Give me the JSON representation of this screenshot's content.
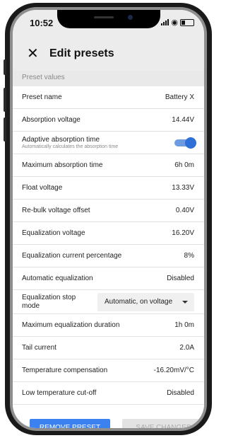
{
  "status_bar": {
    "time": "10:52",
    "wifi_glyph": "◉"
  },
  "appbar": {
    "close_glyph": "✕",
    "title": "Edit presets"
  },
  "section": {
    "header": "Preset values"
  },
  "rows": [
    {
      "label": "Preset name",
      "value": "Battery X"
    },
    {
      "label": "Absorption voltage",
      "value": "14.44V"
    },
    {
      "label": "Adaptive absorption time",
      "sublabel": "Automatically calculates the absorption time",
      "toggle_on": true
    },
    {
      "label": "Maximum absorption time",
      "value": "6h 0m"
    },
    {
      "label": "Float voltage",
      "value": "13.33V"
    },
    {
      "label": "Re-bulk voltage offset",
      "value": "0.40V"
    },
    {
      "label": "Equalization voltage",
      "value": "16.20V"
    },
    {
      "label": "Equalization current percentage",
      "value": "8%"
    },
    {
      "label": "Automatic equalization",
      "value": "Disabled"
    },
    {
      "label": "Equalization stop mode",
      "select_value": "Automatic, on voltage"
    },
    {
      "label": "Maximum equalization duration",
      "value": "1h 0m"
    },
    {
      "label": "Tail current",
      "value": "2.0A"
    },
    {
      "label": "Temperature compensation",
      "value": "-16.20mV/°C"
    },
    {
      "label": "Low temperature cut-off",
      "value": "Disabled"
    }
  ],
  "actions": {
    "remove": "REMOVE PRESET",
    "save": "SAVE CHANGES"
  },
  "colors": {
    "accent": "#3b82f0",
    "toggle_knob": "#2f6fd8",
    "disabled_button": "#e3e3e3"
  }
}
